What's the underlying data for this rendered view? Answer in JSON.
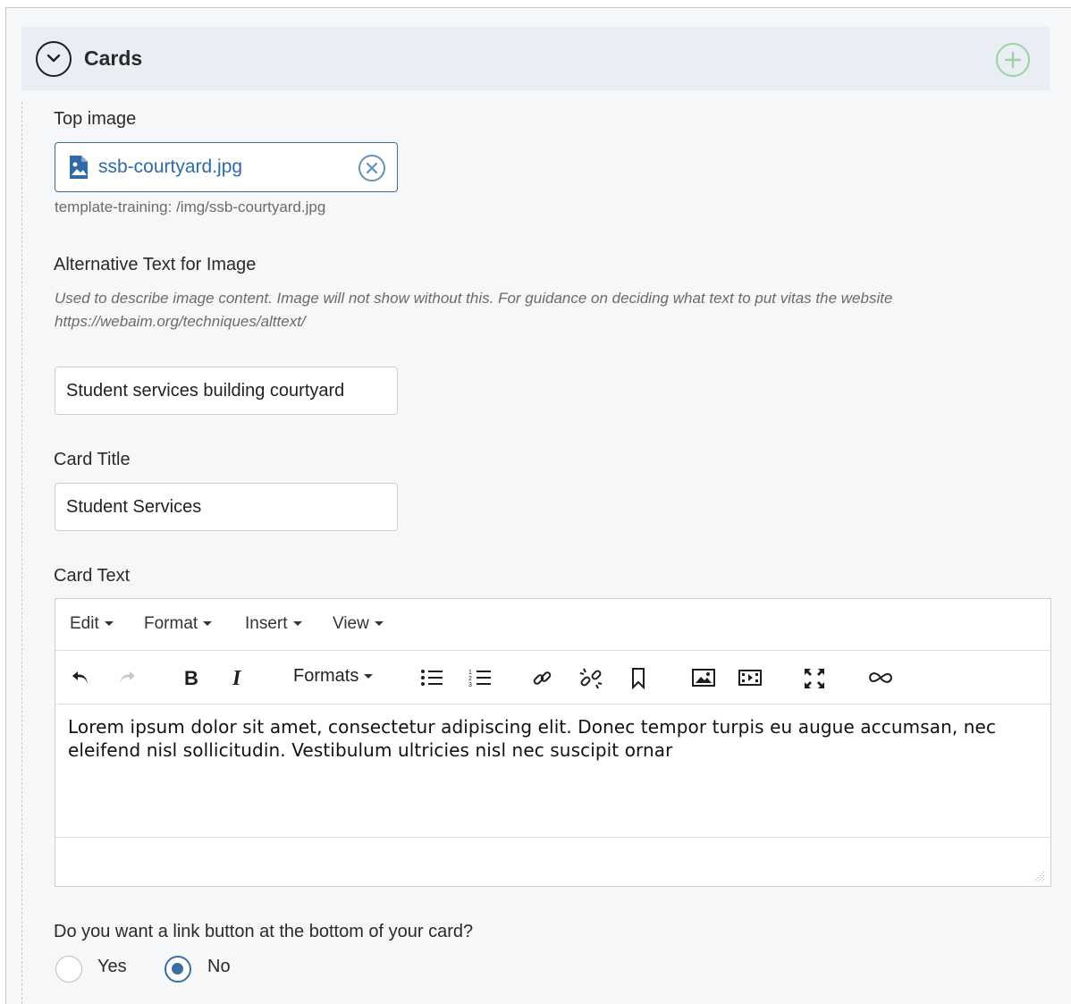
{
  "panel": {
    "title": "Cards"
  },
  "top_image": {
    "label": "Top image",
    "file_name": "ssb-courtyard.jpg",
    "file_path": "template-training: /img/ssb-courtyard.jpg"
  },
  "alt_text": {
    "label": "Alternative Text for Image",
    "help_line1": "Used to describe image content. Image will not show without this. For guidance on deciding what text to put vitas the website",
    "help_line2": "https://webaim.org/techniques/alttext/",
    "value": "Student services building courtyard"
  },
  "card_title": {
    "label": "Card Title",
    "value": "Student Services"
  },
  "card_text": {
    "label": "Card Text",
    "menus": [
      "Edit",
      "Format",
      "Insert",
      "View"
    ],
    "formats_label": "Formats",
    "content_line1": "Lorem ipsum dolor sit amet, consectetur adipiscing elit. Donec tempor turpis eu augue accumsan, nec",
    "content_line2": "eleifend nisl sollicitudin. Vestibulum ultricies nisl nec suscipit ornar"
  },
  "link_question": {
    "label": "Do you want a link button at the bottom of your card?",
    "options": [
      {
        "label": "Yes",
        "checked": false
      },
      {
        "label": "No",
        "checked": true
      }
    ]
  },
  "colors": {
    "accent": "#3a6ea5",
    "header_bg": "#e9eef4",
    "add_green": "#9bd3a7",
    "page_bg": "#f6f7f8"
  },
  "icons": {
    "collapse": "chevron-down-icon",
    "add": "plus-circle-icon",
    "file": "image-file-icon",
    "clear": "close-circle-icon",
    "toolbar": [
      "undo-icon",
      "redo-icon",
      "bold-icon",
      "italic-icon",
      "bullet-list-icon",
      "numbered-list-icon",
      "link-icon",
      "unlink-icon",
      "bookmark-icon",
      "image-icon",
      "media-icon",
      "fullscreen-icon",
      "special-link-icon"
    ]
  }
}
